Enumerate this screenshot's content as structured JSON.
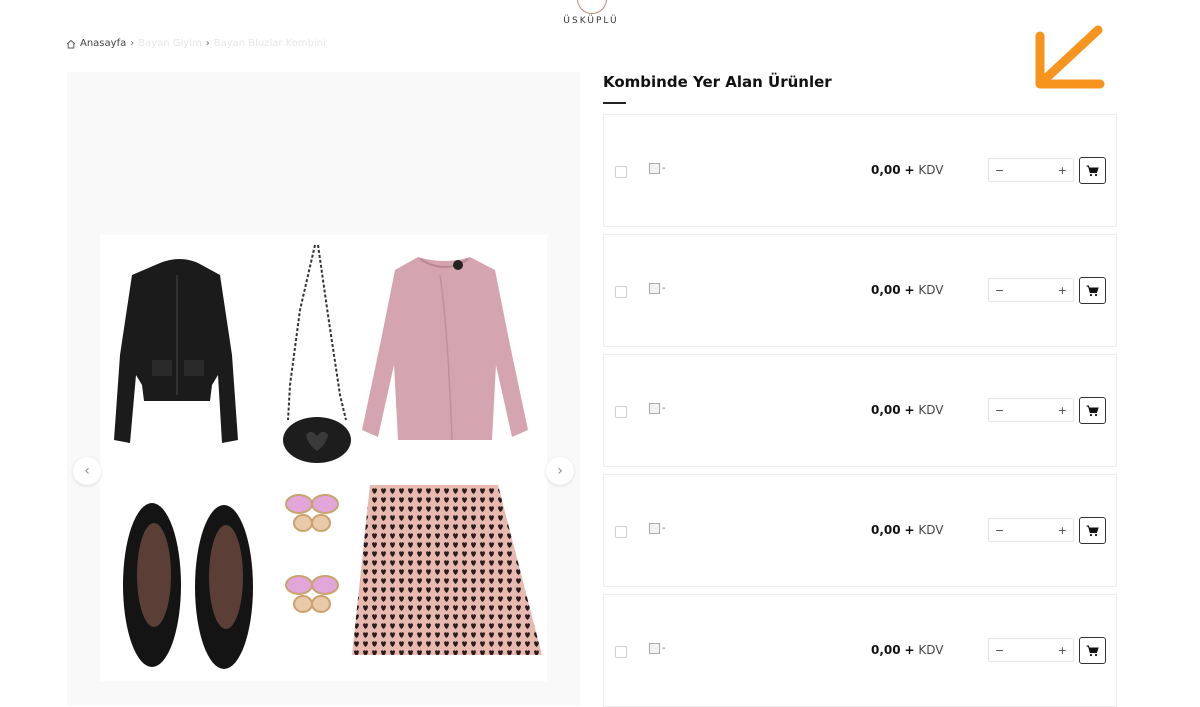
{
  "brand": {
    "logo_text": "ÜSKÜPLÜ"
  },
  "breadcrumb": {
    "home": "Anasayfa",
    "category": "Bayan Giyim",
    "current": "Bayan Bluzlar Kombini"
  },
  "section": {
    "title": "Kombinde Yer Alan Ürünler"
  },
  "products": [
    {
      "thumb_alt": "-",
      "price": "0,00",
      "plus": "+",
      "tax": "KDV",
      "minus": "−",
      "add": "+"
    },
    {
      "thumb_alt": "-",
      "price": "0,00",
      "plus": "+",
      "tax": "KDV",
      "minus": "−",
      "add": "+"
    },
    {
      "thumb_alt": "-",
      "price": "0,00",
      "plus": "+",
      "tax": "KDV",
      "minus": "−",
      "add": "+"
    },
    {
      "thumb_alt": "-",
      "price": "0,00",
      "plus": "+",
      "tax": "KDV",
      "minus": "−",
      "add": "+"
    },
    {
      "thumb_alt": "-",
      "price": "0,00",
      "plus": "+",
      "tax": "KDV",
      "minus": "−",
      "add": "+"
    }
  ],
  "gallery": {
    "prev_icon": "chevron-left-icon",
    "next_icon": "chevron-right-icon"
  },
  "colors": {
    "accent_arrow": "#f7941d",
    "text_dark": "#111111"
  }
}
